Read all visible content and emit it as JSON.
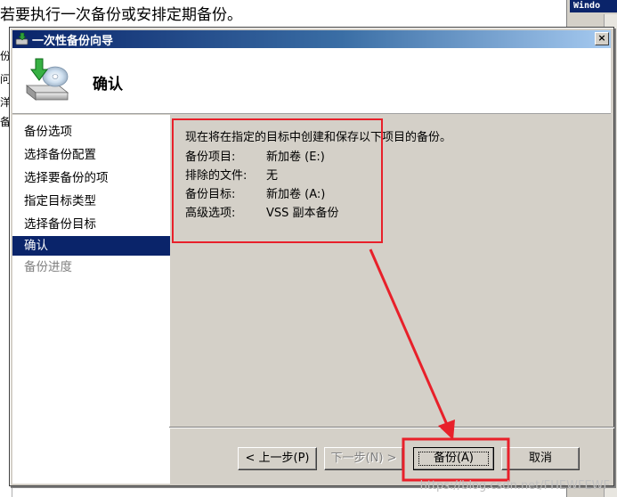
{
  "background": {
    "instruction_text": "若要执行一次备份或安排定期备份。",
    "left_fragments": [
      "份",
      "问",
      "洋",
      "备"
    ],
    "right_title": "Windo"
  },
  "dialog": {
    "title": "一次性备份向导",
    "close_label": "×",
    "header_title": "确认",
    "nav_items": [
      {
        "label": "备份选项",
        "state": "normal"
      },
      {
        "label": "选择备份配置",
        "state": "normal"
      },
      {
        "label": "选择要备份的项",
        "state": "normal"
      },
      {
        "label": "指定目标类型",
        "state": "normal"
      },
      {
        "label": "选择备份目标",
        "state": "normal"
      },
      {
        "label": "确认",
        "state": "active"
      },
      {
        "label": "备份进度",
        "state": "disabled"
      }
    ],
    "intro": "现在将在指定的目标中创建和保存以下项目的备份。",
    "summary": [
      {
        "key": "备份项目:",
        "value": "新加卷 (E:)"
      },
      {
        "key": "排除的文件:",
        "value": "无"
      },
      {
        "key": "备份目标:",
        "value": "新加卷 (A:)"
      },
      {
        "key": "高级选项:",
        "value": "VSS 副本备份"
      }
    ],
    "buttons": {
      "back": "< 上一步(P)",
      "next": "下一步(N) >",
      "backup": "备份(A)",
      "cancel": "取消"
    }
  },
  "annotation_color": "#e8202a",
  "watermark": "https://blog.csdn.net/FHEWFEWF"
}
